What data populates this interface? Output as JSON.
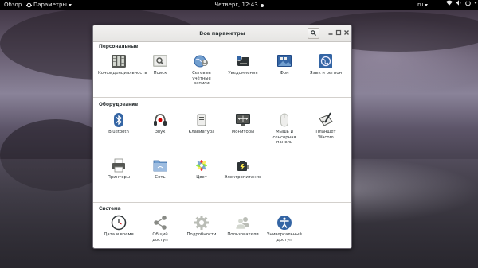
{
  "topbar": {
    "overview": "Обзор",
    "app_menu": "Параметры",
    "clock": "Четверг, 12:43",
    "keyboard_layout": "ru"
  },
  "window": {
    "title": "Все параметры"
  },
  "sections": [
    {
      "title": "Персональные",
      "items": [
        {
          "label": "Конфиденциальность",
          "icon": "privacy-icon"
        },
        {
          "label": "Поиск",
          "icon": "search-settings-icon"
        },
        {
          "label": "Сетевые\nучётные\nзаписи",
          "icon": "online-accounts-icon"
        },
        {
          "label": "Уведомления",
          "icon": "notifications-icon"
        },
        {
          "label": "Фон",
          "icon": "background-icon"
        },
        {
          "label": "Язык и регион",
          "icon": "region-icon"
        }
      ]
    },
    {
      "title": "Оборудование",
      "items": [
        {
          "label": "Bluetooth",
          "icon": "bluetooth-icon"
        },
        {
          "label": "Звук",
          "icon": "sound-icon"
        },
        {
          "label": "Клавиатура",
          "icon": "keyboard-icon"
        },
        {
          "label": "Мониторы",
          "icon": "displays-icon"
        },
        {
          "label": "Мышь и\nсенсорная\nпанель",
          "icon": "mouse-icon"
        },
        {
          "label": "Планшет\nWacom",
          "icon": "wacom-icon"
        },
        {
          "label": "Принтеры",
          "icon": "printer-icon"
        },
        {
          "label": "Сеть",
          "icon": "network-icon"
        },
        {
          "label": "Цвет",
          "icon": "color-icon"
        },
        {
          "label": "Электропитание",
          "icon": "power-icon"
        }
      ]
    },
    {
      "title": "Система",
      "items": [
        {
          "label": "Дата и время",
          "icon": "clock-icon"
        },
        {
          "label": "Общий\nдоступ",
          "icon": "sharing-icon"
        },
        {
          "label": "Подробности",
          "icon": "details-icon"
        },
        {
          "label": "Пользователи",
          "icon": "users-icon"
        },
        {
          "label": "Универсальный\nдоступ",
          "icon": "accessibility-icon"
        }
      ]
    }
  ]
}
